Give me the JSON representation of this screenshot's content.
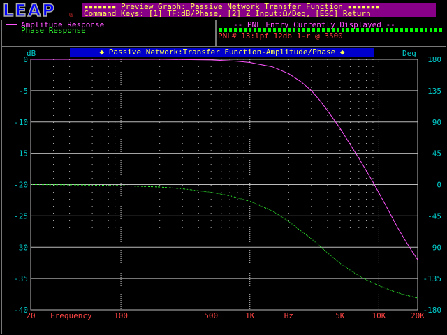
{
  "header": {
    "logo_text": "LEAP",
    "logo_mark": "®",
    "title_line": "▪▪▪▪▪▪▪ Preview Graph: Passive Network Transfer Function ▪▪▪▪▪▪▪",
    "keys_line": "Command Keys: [1] TF:dB/Phase, [2] Z Input:Ω/Deg, [ESC] Return"
  },
  "legend": {
    "amplitude_label": "Amplitude Response",
    "phase_label": "Phase Response"
  },
  "pnl": {
    "title": "-- PNL Entry Currently Displayed --",
    "entry": "PNL# 13:lpf 12db 1-r @ 3500"
  },
  "chart_data": {
    "type": "line",
    "title": "◆ Passive Network:Transfer Function-Amplitude/Phase ◆",
    "ylabel": "dB",
    "y2label": "Deg",
    "xlabel": "Frequency",
    "x_scale": "log",
    "xlim": [
      20,
      20000
    ],
    "ylim": [
      -40,
      0
    ],
    "y2lim": [
      -180,
      180
    ],
    "y_ticks": [
      "0",
      "-5",
      "-10",
      "-15",
      "-20",
      "-25",
      "-30",
      "-35",
      "-40"
    ],
    "y2_ticks": [
      "180",
      "135",
      "90",
      "45",
      "0",
      "-45",
      "-90",
      "-135",
      "-180"
    ],
    "x_tick_labels": [
      {
        "f": 20,
        "label": "20"
      },
      {
        "f": 100,
        "label": "100"
      },
      {
        "f": 500,
        "label": "500"
      },
      {
        "f": 1000,
        "label": "1K"
      },
      {
        "f": 5000,
        "label": "5K"
      },
      {
        "f": 10000,
        "label": "10K"
      },
      {
        "f": 20000,
        "label": "20K"
      }
    ],
    "x_unit_label": {
      "f": 2000,
      "label": "Hz"
    },
    "grid": true,
    "series": [
      {
        "name": "Amplitude Response",
        "axis": "left",
        "color": "#ff55ff",
        "points": [
          [
            20,
            0
          ],
          [
            200,
            0
          ],
          [
            500,
            -0.1
          ],
          [
            800,
            -0.3
          ],
          [
            1000,
            -0.5
          ],
          [
            1500,
            -1.2
          ],
          [
            2000,
            -2.3
          ],
          [
            2500,
            -3.6
          ],
          [
            3000,
            -5.0
          ],
          [
            3500,
            -6.6
          ],
          [
            4000,
            -8.2
          ],
          [
            5000,
            -11.0
          ],
          [
            6000,
            -13.6
          ],
          [
            7000,
            -15.8
          ],
          [
            8000,
            -17.8
          ],
          [
            9000,
            -19.6
          ],
          [
            10000,
            -21.3
          ],
          [
            12000,
            -24.3
          ],
          [
            14000,
            -26.9
          ],
          [
            16000,
            -28.9
          ],
          [
            18000,
            -30.6
          ],
          [
            20000,
            -32.0
          ]
        ]
      },
      {
        "name": "Phase Response",
        "axis": "right",
        "color": "#33ff33",
        "points": [
          [
            20,
            0
          ],
          [
            50,
            -0.5
          ],
          [
            100,
            -1.5
          ],
          [
            200,
            -3.5
          ],
          [
            300,
            -6
          ],
          [
            500,
            -11
          ],
          [
            700,
            -16
          ],
          [
            1000,
            -24
          ],
          [
            1500,
            -38
          ],
          [
            2000,
            -53
          ],
          [
            3000,
            -78
          ],
          [
            4000,
            -98
          ],
          [
            5000,
            -113
          ],
          [
            6000,
            -123
          ],
          [
            7000,
            -131
          ],
          [
            8000,
            -137
          ],
          [
            10000,
            -145
          ],
          [
            12000,
            -151
          ],
          [
            15000,
            -157
          ],
          [
            20000,
            -163
          ]
        ]
      }
    ]
  }
}
